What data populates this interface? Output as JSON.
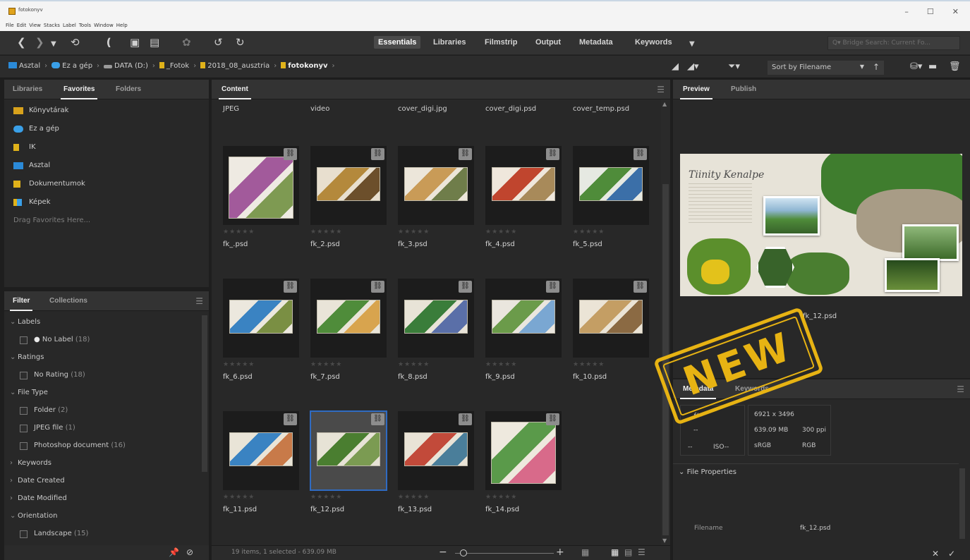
{
  "window": {
    "title": "fotokonyv",
    "menu": [
      "File",
      "Edit",
      "View",
      "Stacks",
      "Label",
      "Tools",
      "Window",
      "Help"
    ],
    "controls": [
      "–",
      "☐",
      "✕"
    ]
  },
  "toolbar": {
    "workspaces": [
      "Essentials",
      "Libraries",
      "Filmstrip",
      "Output",
      "Metadata",
      "Keywords"
    ],
    "active_workspace": "Essentials",
    "search_placeholder": "Q▾  Bridge Search: Current Fo..."
  },
  "path": {
    "crumbs": [
      "Asztal",
      "Ez a gép",
      "DATA (D:)",
      "_Fotok",
      "2018_08_ausztria",
      "fotokonyv"
    ],
    "sort_label": "Sort by Filename"
  },
  "left_top_panel": {
    "tabs": [
      "Libraries",
      "Favorites",
      "Folders"
    ],
    "active_tab": "Favorites",
    "favorites": [
      "Könyvtárak",
      "Ez a gép",
      "IK",
      "Asztal",
      "Dokumentumok",
      "Képek"
    ],
    "drag_hint": "Drag Favorites Here..."
  },
  "filter_panel": {
    "tabs": [
      "Filter",
      "Collections"
    ],
    "active_tab": "Filter",
    "rows": [
      {
        "kind": "section",
        "label": "Labels",
        "expanded": true
      },
      {
        "kind": "option",
        "label": "No Label",
        "count": "(18)",
        "dot": true
      },
      {
        "kind": "section",
        "label": "Ratings",
        "expanded": true
      },
      {
        "kind": "option",
        "label": "No Rating",
        "count": "(18)"
      },
      {
        "kind": "section",
        "label": "File Type",
        "expanded": true
      },
      {
        "kind": "option",
        "label": "Folder",
        "count": "(2)"
      },
      {
        "kind": "option",
        "label": "JPEG file",
        "count": "(1)"
      },
      {
        "kind": "option",
        "label": "Photoshop document",
        "count": "(16)"
      },
      {
        "kind": "section",
        "label": "Keywords",
        "expanded": false
      },
      {
        "kind": "section",
        "label": "Date Created",
        "expanded": false
      },
      {
        "kind": "section",
        "label": "Date Modified",
        "expanded": false
      },
      {
        "kind": "section",
        "label": "Orientation",
        "expanded": true
      },
      {
        "kind": "option",
        "label": "Landscape",
        "count": "(15)"
      }
    ]
  },
  "content": {
    "tab": "Content",
    "top_row_names": [
      "JPEG",
      "video",
      "cover_digi.jpg",
      "cover_digi.psd",
      "cover_temp.psd"
    ],
    "files": [
      "fk_.psd",
      "fk_2.psd",
      "fk_3.psd",
      "fk_4.psd",
      "fk_5.psd",
      "fk_6.psd",
      "fk_7.psd",
      "fk_8.psd",
      "fk_9.psd",
      "fk_10.psd",
      "fk_11.psd",
      "fk_12.psd",
      "fk_13.psd",
      "fk_14.psd"
    ],
    "selected": "fk_12.psd",
    "status": "19 items, 1 selected - 639.09 MB",
    "stars": "★★★★★"
  },
  "preview": {
    "tabs": [
      "Preview",
      "Publish"
    ],
    "active_tab": "Preview",
    "title_script": "Tiinity Kenalpe",
    "filename": "fk_12.psd"
  },
  "metadata": {
    "tabs": [
      "Metadata",
      "Keywords"
    ],
    "active_tab": "Metadata",
    "dimensions": "6921 x 3496",
    "size": "639.09 MB",
    "resolution": "300 ppi",
    "color_profile": "sRGB",
    "color_mode": "RGB",
    "camera_left": [
      "f/--",
      "--",
      "--"
    ],
    "iso": "ISO--",
    "section": "File Properties",
    "filename_label": "Filename",
    "filename_value": "fk_12.psd"
  },
  "stamp": {
    "text": "NEW"
  },
  "colors": {
    "accent_selection": "#2f6bc2",
    "stamp": "#e7b313",
    "folder": "#e0b21a",
    "desktop": "#2b8ad8"
  }
}
